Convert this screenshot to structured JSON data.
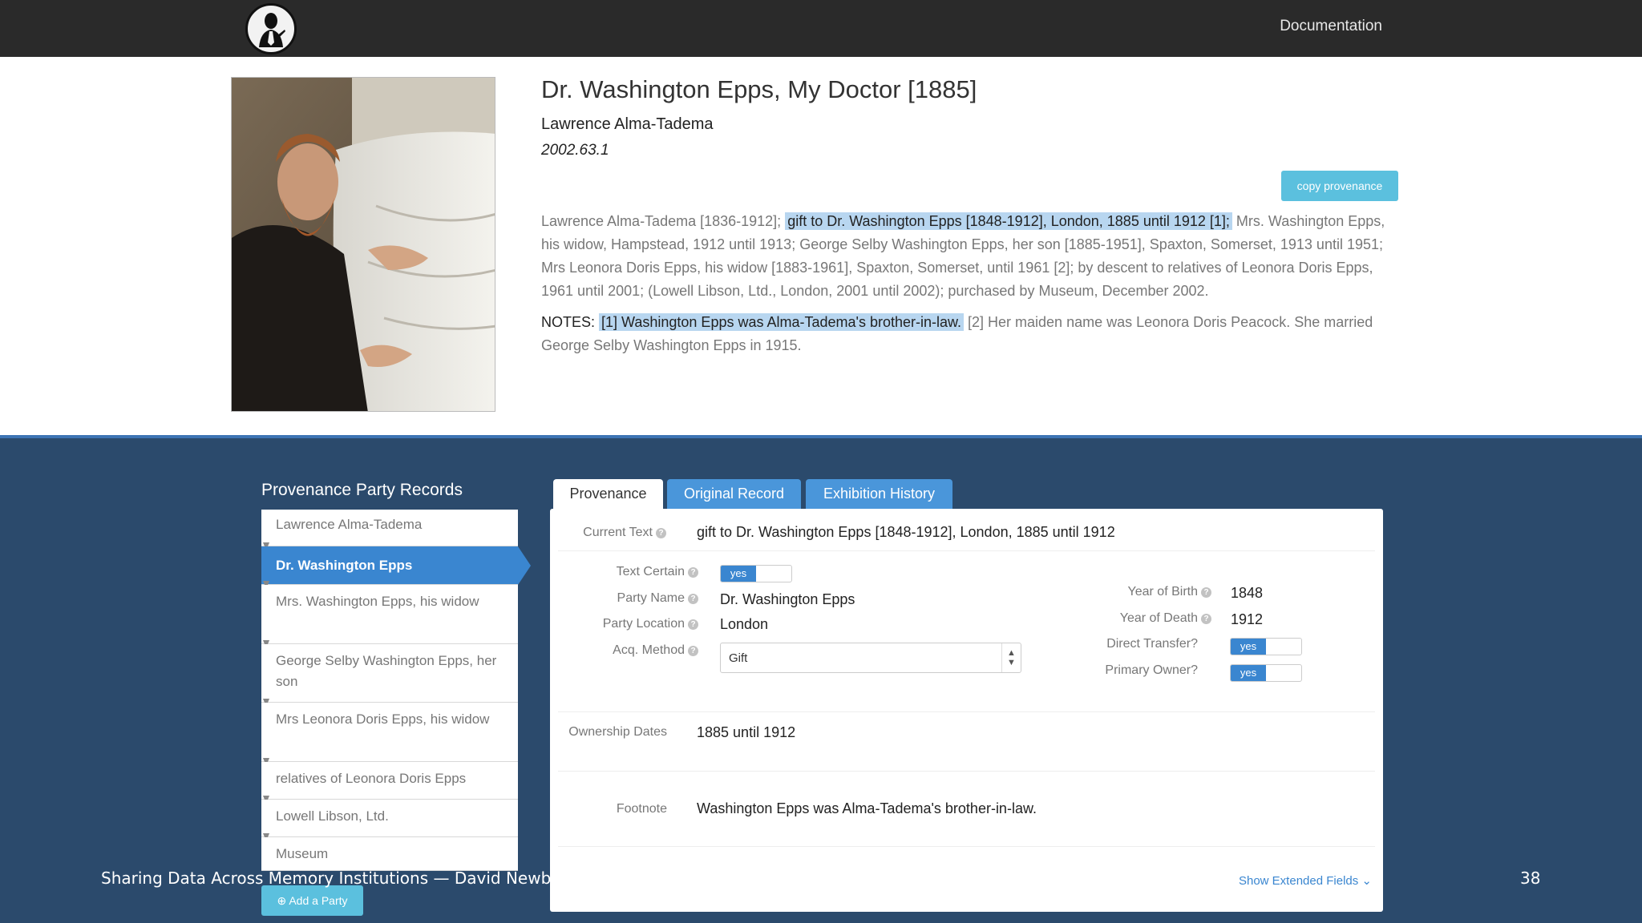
{
  "nav": {
    "documentation": "Documentation"
  },
  "artwork": {
    "title": "Dr. Washington Epps, My Doctor [1885]",
    "artist": "Lawrence Alma-Tadema",
    "accession": "2002.63.1",
    "copy_button": "copy provenance",
    "provenance_before": "Lawrence Alma-Tadema [1836-1912]; ",
    "provenance_highlight": "gift to Dr. Washington Epps [1848-1912], London, 1885 until 1912 [1];",
    "provenance_after": " Mrs. Washington Epps, his widow, Hampstead, 1912 until 1913;  George Selby Washington Epps, her son [1885-1951], Spaxton, Somerset, 1913 until 1951;  Mrs Leonora Doris Epps, his widow [1883-1961], Spaxton, Somerset, until 1961 [2];  by descent to relatives of Leonora Doris Epps, 1961 until 2001;  (Lowell Libson, Ltd., London, 2001 until 2002);  purchased by Museum, December 2002.",
    "notes_label": "NOTES:",
    "notes_highlight": "[1] Washington Epps was Alma-Tadema's brother-in-law.",
    "notes_after": " [2] Her maiden name was Leonora Doris Peacock. She married George Selby Washington Epps in 1915."
  },
  "parties": {
    "heading": "Provenance Party Records",
    "items": [
      "Lawrence Alma-Tadema",
      "Dr. Washington Epps",
      "Mrs. Washington Epps, his widow",
      "George Selby Washington Epps, her son",
      "Mrs Leonora Doris Epps, his widow",
      "relatives of Leonora Doris Epps",
      "Lowell Libson, Ltd.",
      "Museum"
    ],
    "active_index": 1,
    "add_button": "Add a Party"
  },
  "tabs": [
    "Provenance",
    "Original Record",
    "Exhibition History"
  ],
  "record": {
    "current_text_label": "Current Text",
    "current_text": "gift to Dr. Washington Epps [1848-1912], London, 1885 until 1912",
    "text_certain_label": "Text Certain",
    "text_certain": "yes",
    "party_name_label": "Party Name",
    "party_name": "Dr. Washington Epps",
    "party_location_label": "Party Location",
    "party_location": "London",
    "acq_method_label": "Acq. Method",
    "acq_method": "Gift",
    "year_of_birth_label": "Year of Birth",
    "year_of_birth": "1848",
    "year_of_death_label": "Year of Death",
    "year_of_death": "1912",
    "direct_transfer_label": "Direct Transfer?",
    "direct_transfer": "yes",
    "primary_owner_label": "Primary Owner?",
    "primary_owner": "yes",
    "ownership_dates_label": "Ownership Dates",
    "ownership_dates": "1885 until 1912",
    "footnote_label": "Footnote",
    "footnote": "Washington Epps was Alma-Tadema's brother-in-law.",
    "show_extended": "Show Extended Fields"
  },
  "slide": {
    "footer": "Sharing Data Across Memory Institutions — David Newbury",
    "number": "38"
  }
}
